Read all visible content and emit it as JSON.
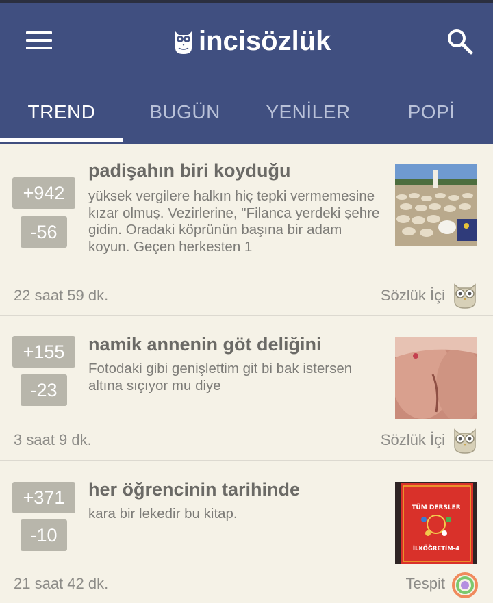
{
  "app": {
    "title": "incisözlük",
    "tabs": [
      {
        "label": "TREND",
        "active": true
      },
      {
        "label": "BUGÜN",
        "active": false
      },
      {
        "label": "YENİLER",
        "active": false
      },
      {
        "label": "POPİ",
        "active": false
      }
    ],
    "menu_icon": "hamburger-menu-icon",
    "search_icon": "search-icon",
    "logo_icon": "owl-icon"
  },
  "colors": {
    "appbar": "#404f80",
    "background": "#f5f2e7",
    "vote_badge": "#b8b6ab",
    "title_text": "#6b6a66"
  },
  "entries": [
    {
      "upvotes": "+942",
      "downvotes": "-56",
      "title": "padişahın biri koyduğu",
      "excerpt": "yüksek vergilere halkın hiç tepki vermemesine kızar olmuş. Vezirlerine, \"Filanca yerdeki şehre gidin. Oradaki köprünün başına bir adam koyun. Geçen herkesten 1",
      "time": "22 saat 59 dk.",
      "source": "Sözlük İçi",
      "source_icon": "owl-icon",
      "thumbnail": "sheep-flock-photo"
    },
    {
      "upvotes": "+155",
      "downvotes": "-23",
      "title": "namik annenin göt deliğini",
      "excerpt": "Fotodaki gibi genişlettim git bi bak istersen altına sıçıyor mu diye",
      "time": "3 saat 9 dk.",
      "source": "Sözlük İçi",
      "source_icon": "owl-icon",
      "thumbnail": "skin-photo"
    },
    {
      "upvotes": "+371",
      "downvotes": "-10",
      "title": "her öğrencinin tarihinde",
      "excerpt": "kara bir lekedir bu kitap.",
      "time": "21 saat 42 dk.",
      "source": "Tespit",
      "source_icon": "magnifier-icon",
      "thumbnail": "red-book-photo",
      "book_title_top": "TÜM DERSLER",
      "book_title_bottom": "İLKÖĞRETİM-4"
    }
  ]
}
